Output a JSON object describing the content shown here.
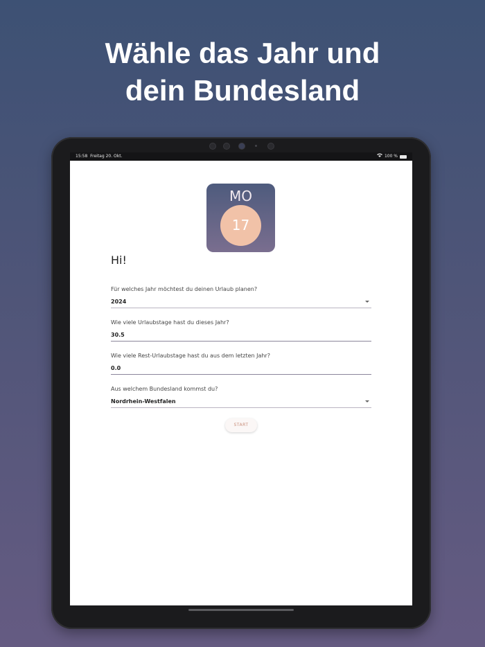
{
  "headline": {
    "line1": "Wähle das Jahr und",
    "line2": "dein Bundesland"
  },
  "statusbar": {
    "time": "15:58",
    "date": "Freitag 20. Okt.",
    "battery": "100 %"
  },
  "logo": {
    "weekday": "MO",
    "day": "17"
  },
  "form": {
    "greeting": "Hi!",
    "year_label": "Für welches Jahr möchtest du deinen Urlaub planen?",
    "year_value": "2024",
    "vacation_days_label": "Wie viele Urlaubstage hast du dieses Jahr?",
    "vacation_days_value": "30.5",
    "remaining_days_label": "Wie viele Rest-Urlaubstage hast du aus dem letzten Jahr?",
    "remaining_days_value": "0.0",
    "state_label": "Aus welchem Bundesland kommst du?",
    "state_value": "Nordrhein-Westfalen",
    "start_label": "START"
  },
  "colors": {
    "logo_circle": "#f1c2a8",
    "start_text": "#c78d7a"
  }
}
